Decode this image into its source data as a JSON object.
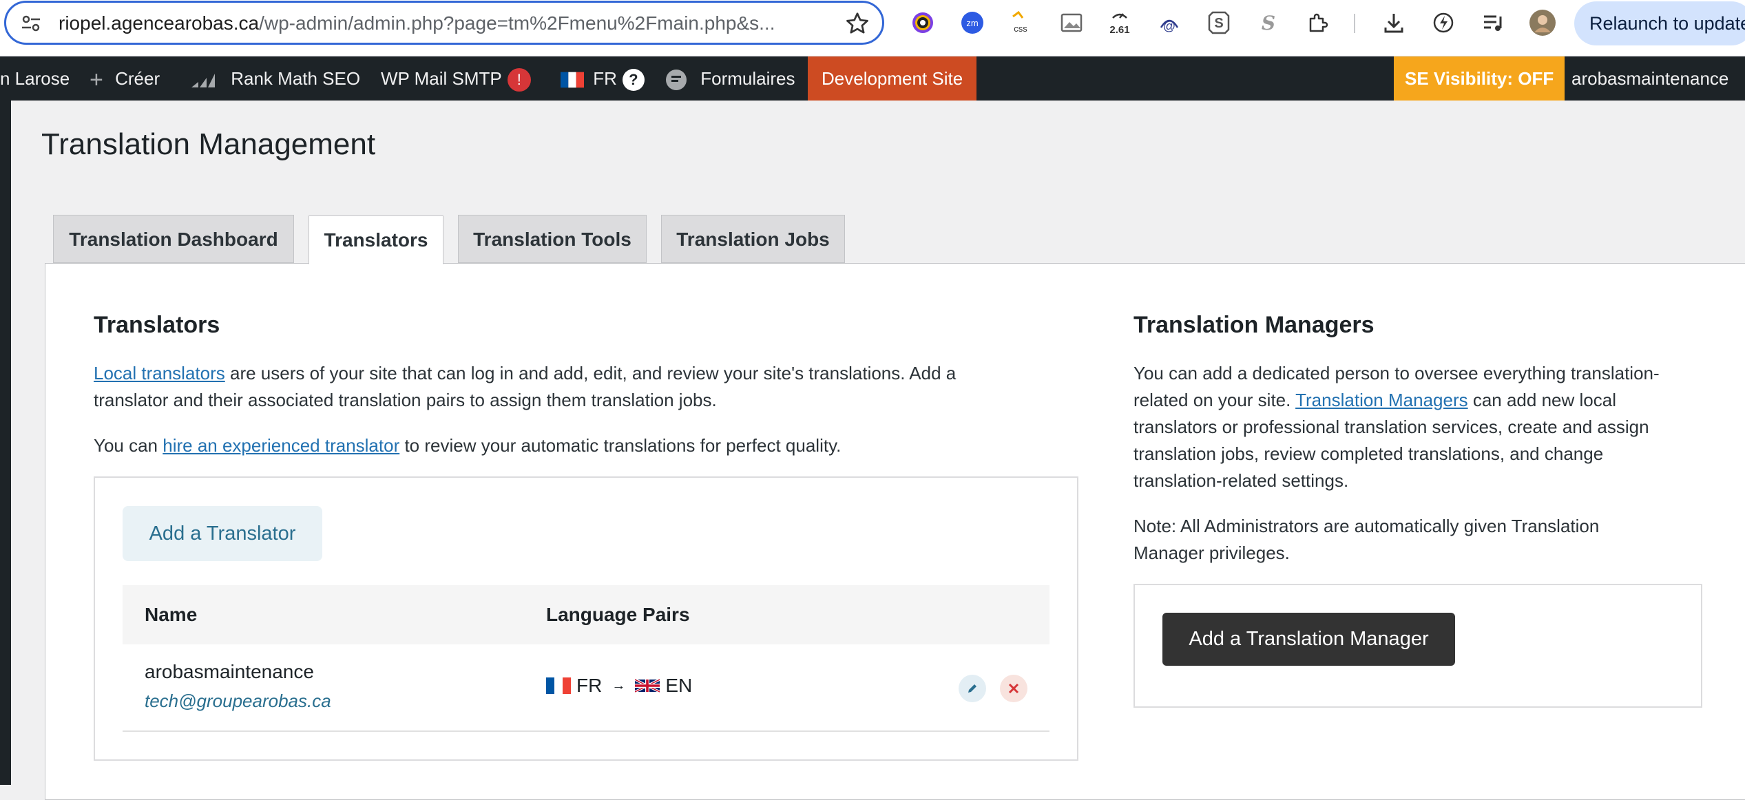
{
  "browser": {
    "url_host": "riopel.agencearobas.ca",
    "url_path": "/wp-admin/admin.php?page=tm%2Fmenu%2Fmain.php&s...",
    "relaunch_label": "Relaunch to update",
    "extension_badge": "2.61",
    "extensions": [
      "colorzilla-icon",
      "zoom-icon",
      "css-icon",
      "image-icon",
      "counter-icon",
      "arobase-icon",
      "s-box-icon",
      "s-script-icon",
      "puzzle-icon",
      "download-icon",
      "performance-icon",
      "media-queue-icon",
      "profile-avatar"
    ]
  },
  "adminbar": {
    "site_fragment": "n Larose",
    "create_label": "Créer",
    "rankmath_label": "Rank Math SEO",
    "mailsmtp_label": "WP Mail SMTP",
    "mailsmtp_badge": "!",
    "lang_label": "FR",
    "lang_help": "?",
    "forms_label": "Formulaires",
    "devsite_label": "Development Site",
    "se_visibility_label": "SE Visibility: OFF",
    "user_label": "arobasmaintenance",
    "colors": {
      "bar": "#1d2327",
      "devsite": "#cd4b22",
      "se_visibility": "#f6a61c"
    }
  },
  "page": {
    "title": "Translation Management",
    "tabs": [
      {
        "label": "Translation Dashboard",
        "active": false
      },
      {
        "label": "Translators",
        "active": true
      },
      {
        "label": "Translation Tools",
        "active": false
      },
      {
        "label": "Translation Jobs",
        "active": false
      }
    ]
  },
  "translators": {
    "heading": "Translators",
    "intro_link": "Local translators",
    "intro_line1_rest": " are users of your site that can log in and add, edit, and review your site's translations. Add a",
    "intro_line2": "translator and their associated translation pairs to assign them translation jobs.",
    "hire_prefix": "You can ",
    "hire_link": "hire an experienced translator",
    "hire_suffix": " to review your automatic translations for perfect quality.",
    "add_button": "Add a Translator",
    "columns": {
      "name": "Name",
      "pairs": "Language Pairs"
    },
    "rows": [
      {
        "name": "arobasmaintenance",
        "email": "tech@groupearobas.ca",
        "from": "FR",
        "arrow": "→",
        "to": "EN",
        "from_flag": "flag-fr-icon",
        "to_flag": "flag-gb-icon"
      }
    ]
  },
  "managers": {
    "heading": "Translation Managers",
    "line1": "You can add a dedicated person to oversee everything translation-",
    "line2_prefix": "related on your site. ",
    "line2_link": "Translation Managers",
    "line2_suffix": " can add new local",
    "line3": "translators or professional translation services, create and assign",
    "line4": "translation jobs, review completed translations, and change",
    "line5": "translation-related settings.",
    "note_line1": "Note: All Administrators are automatically given Translation",
    "note_line2": "Manager privileges.",
    "add_button": "Add a Translation Manager"
  },
  "colors": {
    "link": "#2271b1",
    "dark_button": "#333333",
    "light_button": "#e9f2f6"
  }
}
